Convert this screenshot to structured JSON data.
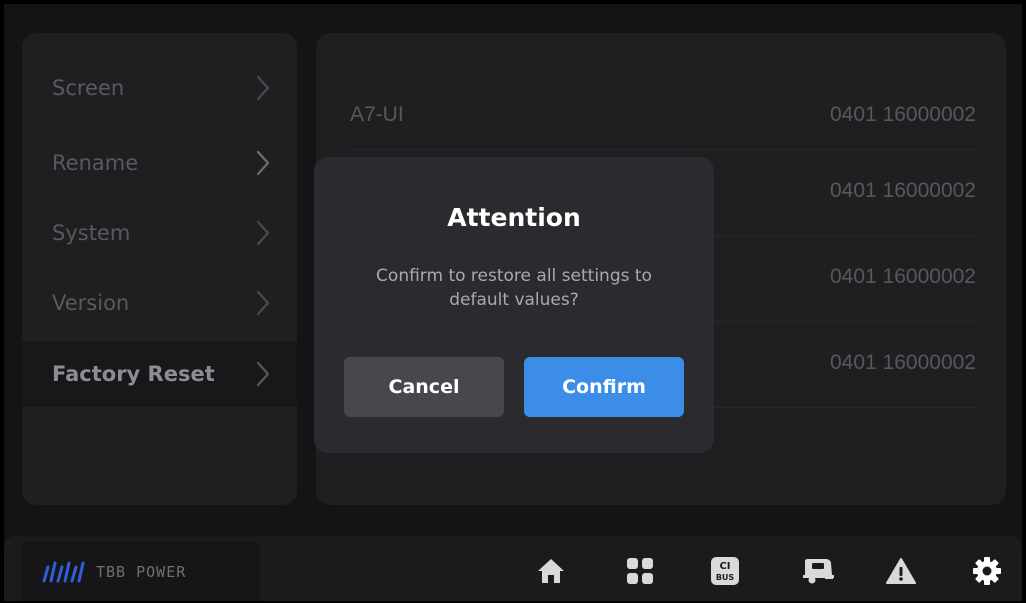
{
  "sidebar": {
    "items": [
      {
        "label": "Screen"
      },
      {
        "label": "Rename"
      },
      {
        "label": "System"
      },
      {
        "label": "Version"
      },
      {
        "label": "Factory Reset"
      }
    ],
    "active": "Factory Reset"
  },
  "main": {
    "rows": [
      {
        "name": "A7-UI",
        "value": "0401 16000002"
      },
      {
        "name": "",
        "value": "0401 16000002"
      },
      {
        "name": "",
        "value": "0401 16000002"
      },
      {
        "name": "",
        "value": "0401 16000002"
      }
    ]
  },
  "dialog": {
    "title": "Attention",
    "message": "Confirm to restore all settings to default values?",
    "cancel_label": "Cancel",
    "confirm_label": "Confirm"
  },
  "bottom_bar": {
    "logo_text": "TBB POWER",
    "icons": [
      "home-icon",
      "grid-icon",
      "ci-bus-icon",
      "caravan-icon",
      "warning-icon",
      "gear-icon"
    ],
    "ci_bus_top": "CI",
    "ci_bus_bottom": "BUS"
  },
  "colors": {
    "background": "#141416",
    "panel": "#1f1f22",
    "dialog": "#2b2b2f",
    "accent": "#3b8de7",
    "cancel": "#48484c"
  }
}
